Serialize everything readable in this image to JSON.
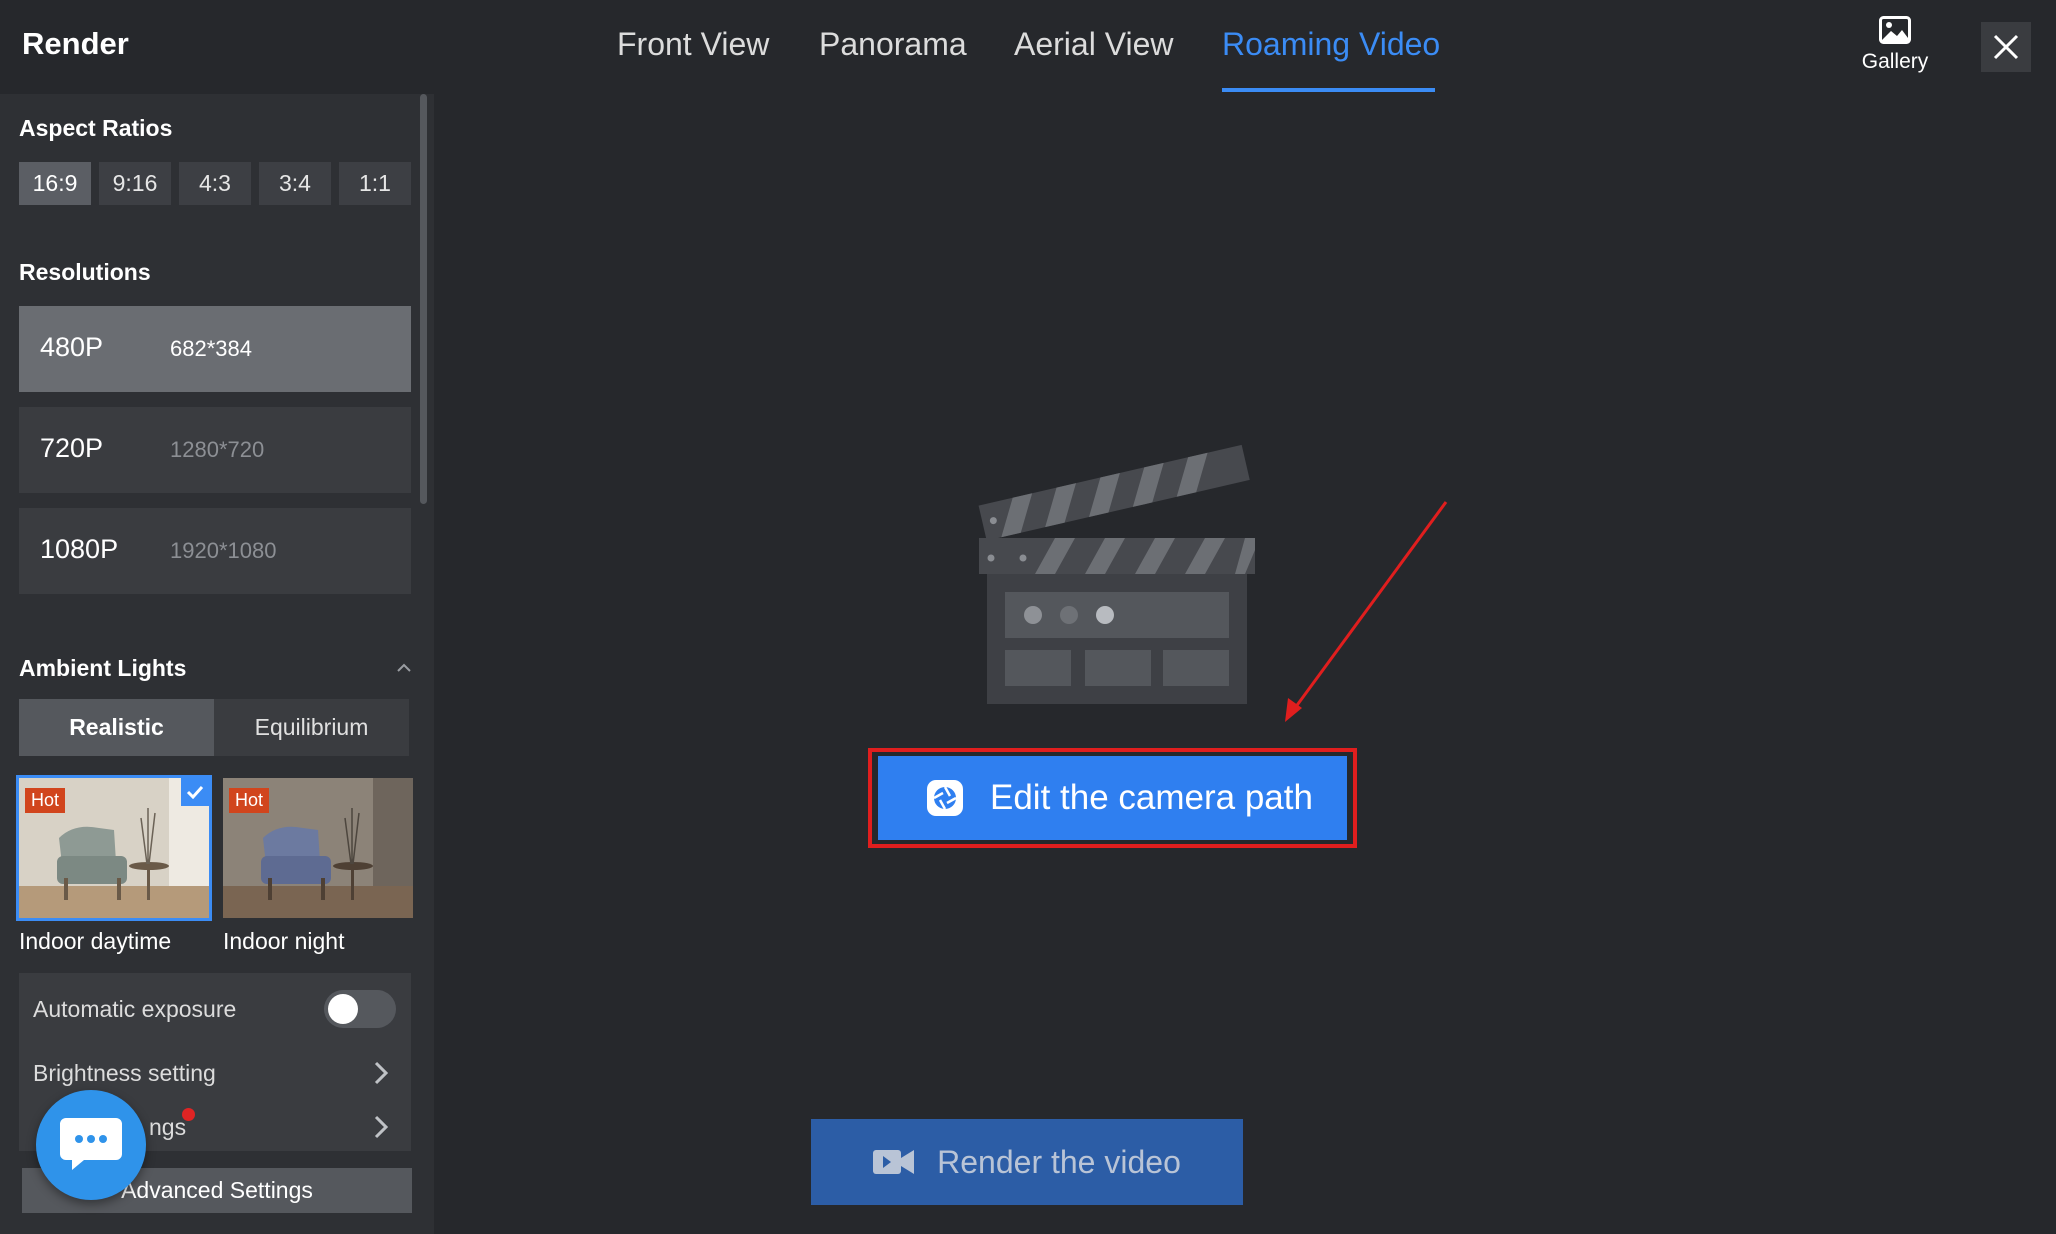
{
  "app": {
    "title": "Render"
  },
  "tabs": [
    {
      "label": "Front View",
      "active": false
    },
    {
      "label": "Panorama",
      "active": false
    },
    {
      "label": "Aerial View",
      "active": false
    },
    {
      "label": "Roaming Video",
      "active": true
    }
  ],
  "header": {
    "gallery_label": "Gallery",
    "gallery_icon": "image-icon",
    "close_icon": "close-icon"
  },
  "aspect_ratios": {
    "title": "Aspect Ratios",
    "options": [
      "16:9",
      "9:16",
      "4:3",
      "3:4",
      "1:1"
    ],
    "selected": "16:9"
  },
  "resolutions": {
    "title": "Resolutions",
    "items": [
      {
        "label": "480P",
        "dims": "682*384",
        "selected": true
      },
      {
        "label": "720P",
        "dims": "1280*720",
        "selected": false
      },
      {
        "label": "1080P",
        "dims": "1920*1080",
        "selected": false
      }
    ]
  },
  "ambient_lights": {
    "title": "Ambient Lights",
    "modes": [
      "Realistic",
      "Equilibrium"
    ],
    "selected_mode": "Realistic",
    "presets": [
      {
        "label": "Indoor daytime",
        "badge": "Hot",
        "selected": true
      },
      {
        "label": "Indoor night",
        "badge": "Hot",
        "selected": false
      }
    ]
  },
  "settings": {
    "auto_exposure_label": "Automatic exposure",
    "auto_exposure_on": false,
    "brightness_label": "Brightness setting",
    "partial_row_label": "ngs",
    "advanced_label": "Advanced Settings"
  },
  "main": {
    "edit_button_label": "Edit the camera path",
    "render_button_label": "Render the video"
  },
  "colors": {
    "accent": "#3b8cf5",
    "edit_button": "#2f7ff0",
    "render_button": "#2c5da6",
    "highlight": "#e01e1e",
    "badge": "#d1451d"
  }
}
